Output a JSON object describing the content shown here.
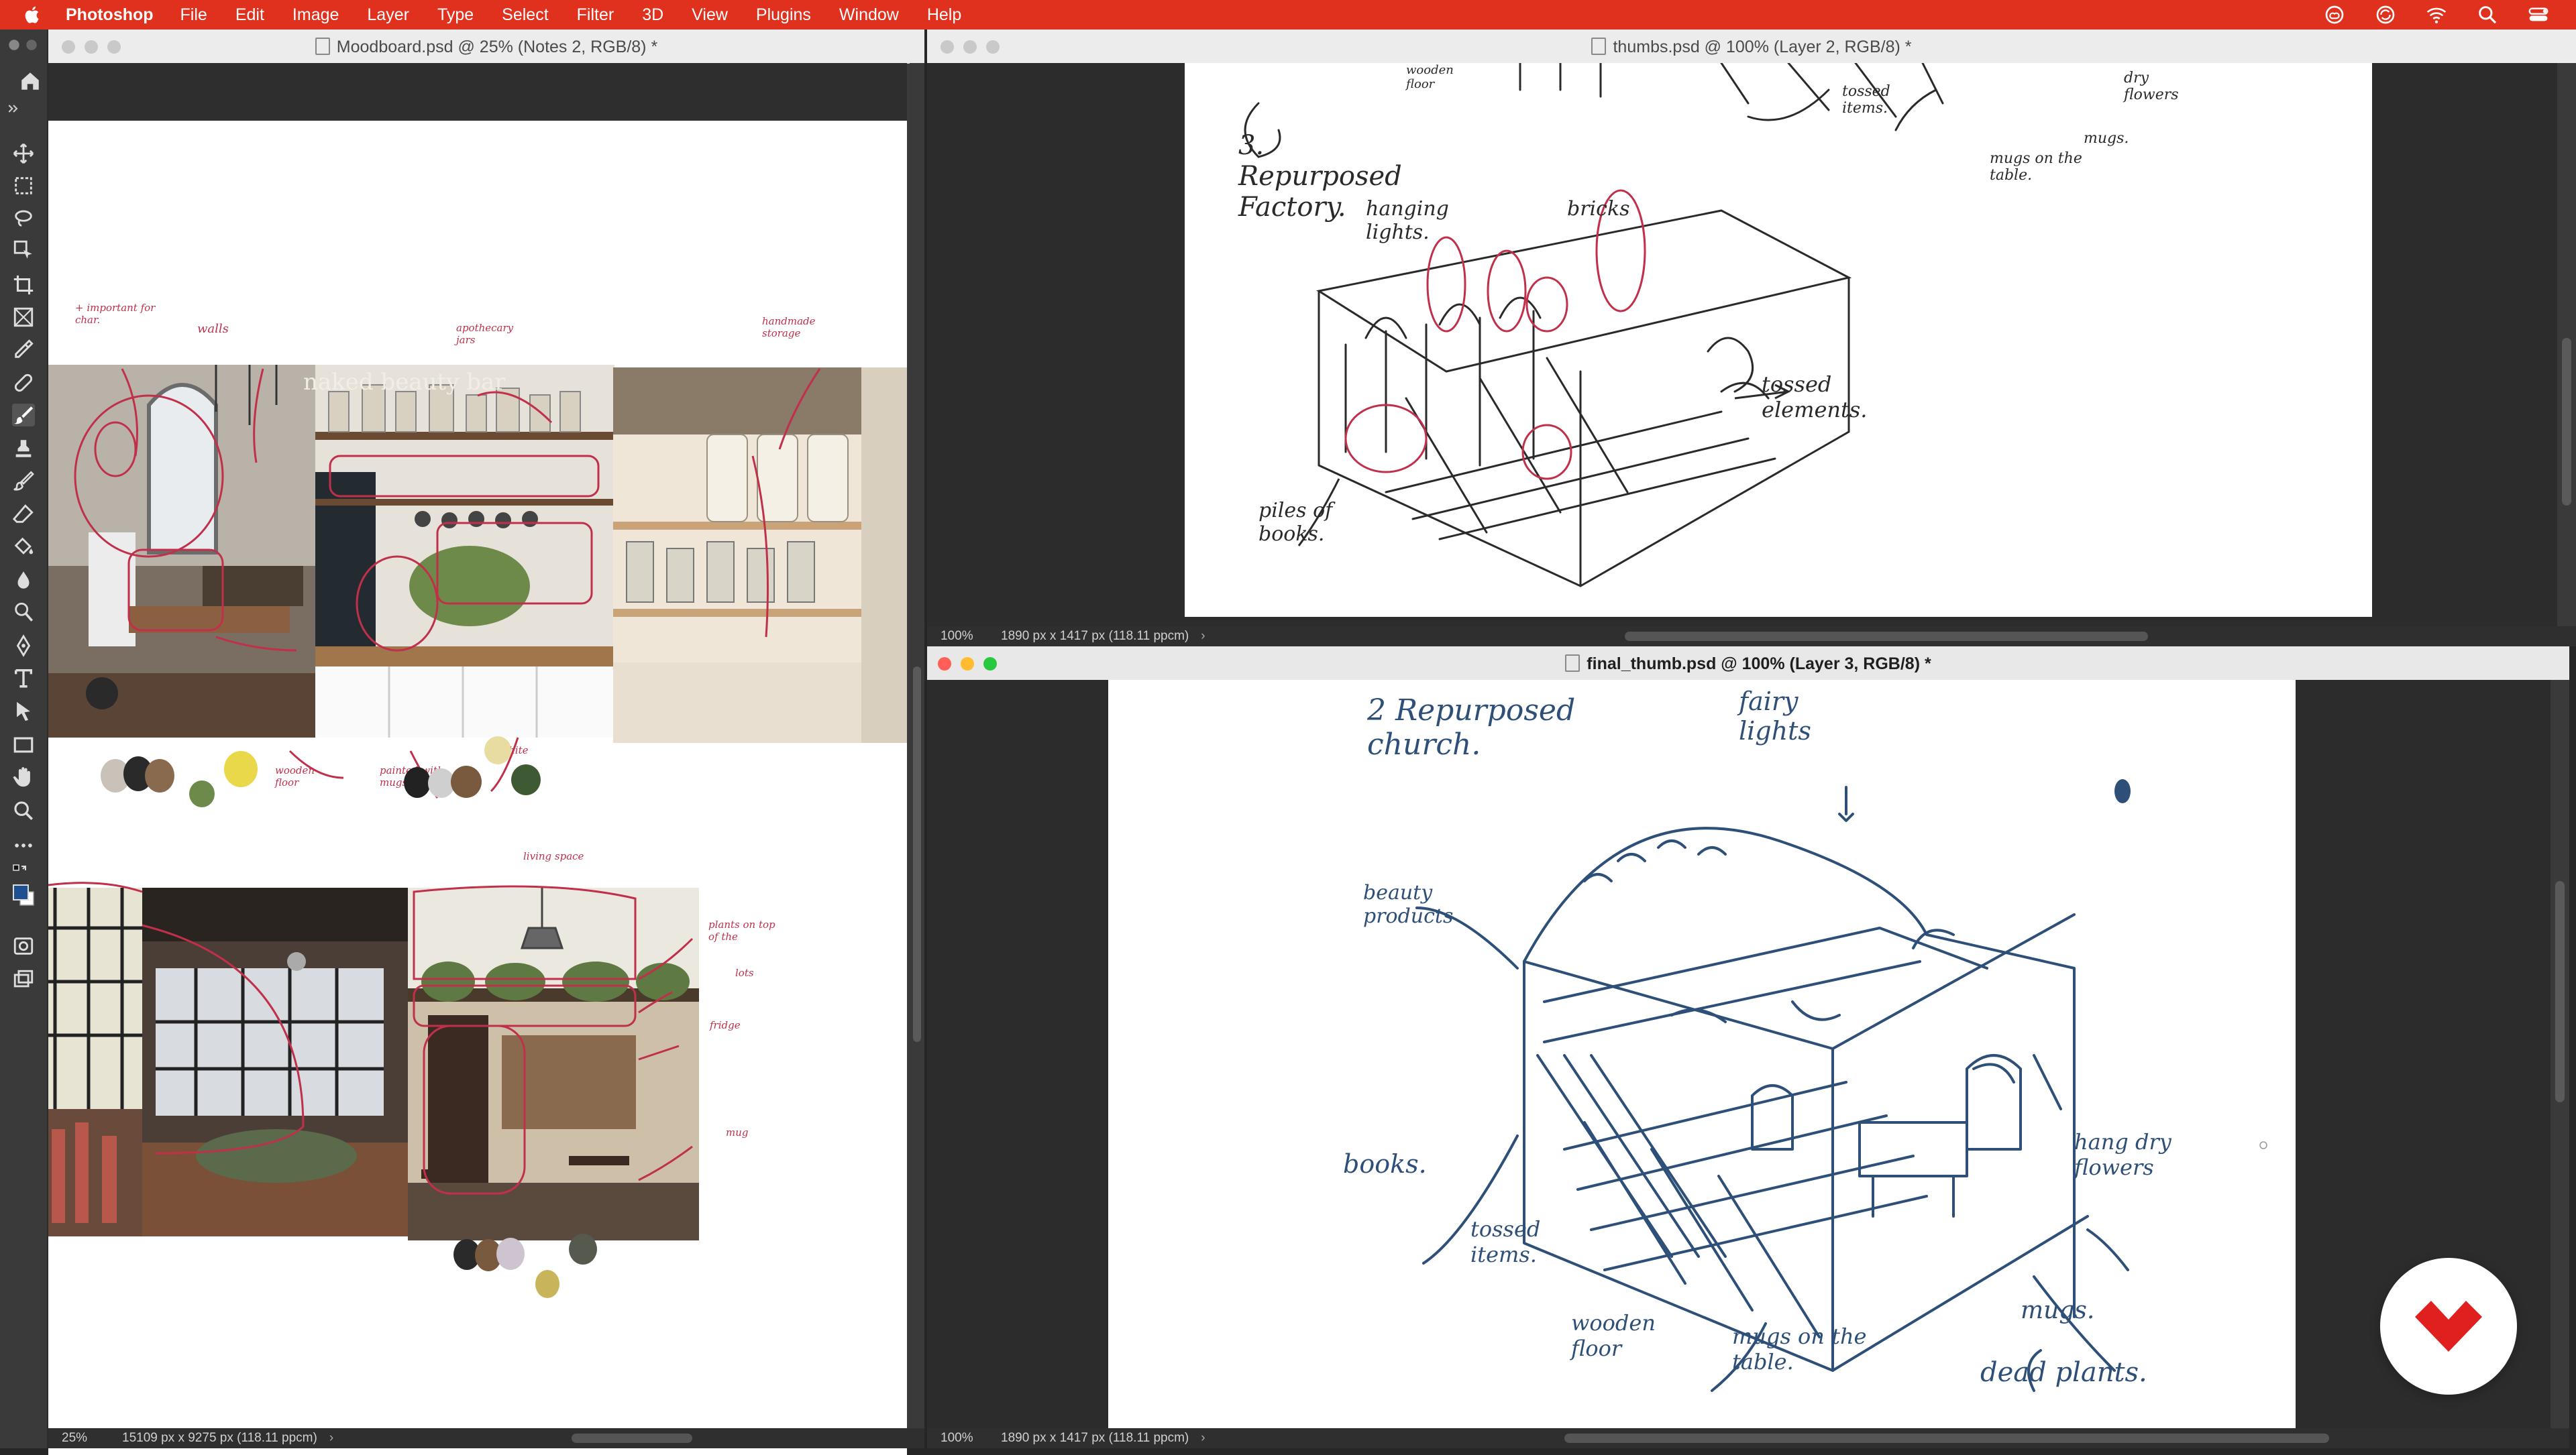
{
  "menubar": {
    "app_name": "Photoshop",
    "items": [
      "File",
      "Edit",
      "Image",
      "Layer",
      "Type",
      "Select",
      "Filter",
      "3D",
      "View",
      "Plugins",
      "Window",
      "Help"
    ],
    "accent": "#e0301e"
  },
  "toolbar": {
    "tools": [
      "home-icon",
      "move-icon",
      "marquee-icon",
      "lasso-icon",
      "object-select-icon",
      "crop-icon",
      "frame-icon",
      "eyedropper-icon",
      "healing-icon",
      "brush-icon",
      "stamp-icon",
      "history-brush-icon",
      "eraser-icon",
      "paint-bucket-icon",
      "blur-icon",
      "dodge-icon",
      "pen-icon",
      "type-icon",
      "path-select-icon",
      "rectangle-icon",
      "hand-icon",
      "zoom-icon",
      "more-icon",
      "swap-colors-icon",
      "foreground-color",
      "quick-mask-icon",
      "screen-mode-icon"
    ],
    "foreground_color": "#1e4f8f"
  },
  "moodboard": {
    "title": "Moodboard.psd @ 25% (Notes 2, RGB/8) *",
    "zoom": "25%",
    "dims": "15109 px x 9275 px (118.11 ppcm)",
    "notes": [
      "+ important for char.",
      "walls",
      "apothecary jars",
      "handmade storage",
      "wooden floor",
      "painted with mugs",
      "all white",
      "living space",
      "plants on top of the",
      "lots",
      "fridge",
      "mug"
    ],
    "sign_text": "naked beauty bar",
    "palette1": [
      "#c8c2b8",
      "#2a2a2a",
      "#8a6a4e",
      "#6e8a4a",
      "#e8d84a"
    ],
    "palette2": [
      "#222222",
      "#cfcfcf",
      "#7a5a3e",
      "#e8dca0",
      "#3e5a34"
    ],
    "palette3": [
      "#2a2a2a",
      "#7a5a3e",
      "#cdc4d0",
      "#c8b45a",
      "#55594e"
    ]
  },
  "thumbs": {
    "title": "thumbs.psd @ 100% (Layer 2, RGB/8) *",
    "zoom": "100%",
    "dims": "1890 px x 1417 px (118.11 ppcm)",
    "labels": [
      "3. Repurposed Factory.",
      "hanging lights.",
      "bricks",
      "tossed elements.",
      "piles of books.",
      "wooden floor",
      "tossed items.",
      "mugs on the table.",
      "mugs.",
      "dry flowers"
    ]
  },
  "final": {
    "title": "final_thumb.psd @ 100% (Layer 3, RGB/8) *",
    "zoom": "100%",
    "dims": "1890 px x 1417 px (118.11 ppcm)",
    "labels": [
      "2 Repurposed church.",
      "fairy lights",
      "beauty products",
      "books.",
      "tossed items.",
      "wooden floor",
      "mugs on the table.",
      "mugs.",
      "hang dry flowers",
      "dead plants."
    ],
    "ink_color": "#2d4f78"
  },
  "fab_icon": "brand-logo-icon"
}
